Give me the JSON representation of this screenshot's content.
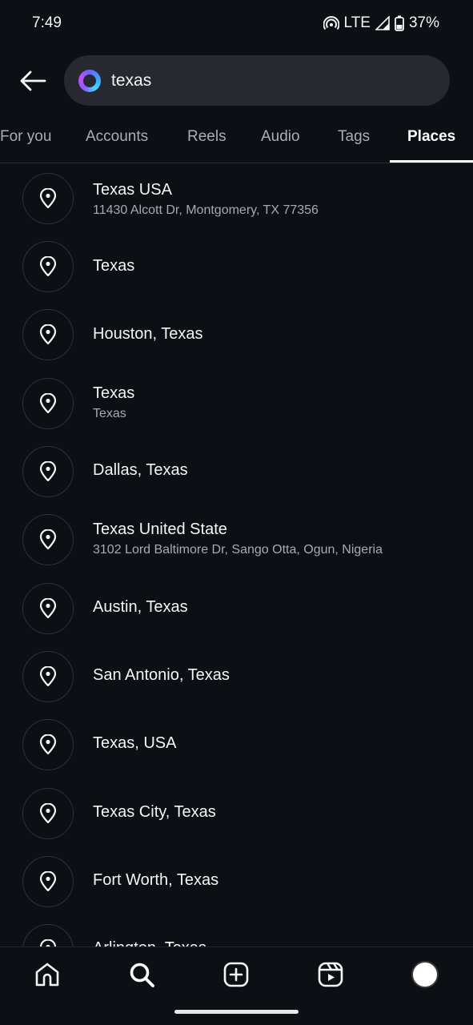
{
  "status_bar": {
    "time": "7:49",
    "network": "LTE",
    "battery": "37%",
    "icons": [
      "hotspot-icon",
      "signal-icon",
      "battery-icon"
    ]
  },
  "search": {
    "query": "texas",
    "logo_icon": "meta-ai-ring-icon",
    "back_icon": "back-arrow-icon"
  },
  "tabs": [
    {
      "label": "For you",
      "active": false
    },
    {
      "label": "Accounts",
      "active": false
    },
    {
      "label": "Reels",
      "active": false
    },
    {
      "label": "Audio",
      "active": false
    },
    {
      "label": "Tags",
      "active": false
    },
    {
      "label": "Places",
      "active": true
    }
  ],
  "places": [
    {
      "name": "Texas USA",
      "address": "11430 Alcott Dr, Montgomery, TX 77356"
    },
    {
      "name": "Texas",
      "address": ""
    },
    {
      "name": "Houston, Texas",
      "address": ""
    },
    {
      "name": "Texas",
      "address": "Texas"
    },
    {
      "name": "Dallas, Texas",
      "address": ""
    },
    {
      "name": "Texas United State",
      "address": "3102  Lord Baltimore Dr, Sango Otta, Ogun, Nigeria"
    },
    {
      "name": "Austin, Texas",
      "address": ""
    },
    {
      "name": "San Antonio, Texas",
      "address": ""
    },
    {
      "name": "Texas, USA",
      "address": ""
    },
    {
      "name": "Texas City, Texas",
      "address": ""
    },
    {
      "name": "Fort Worth, Texas",
      "address": ""
    },
    {
      "name": "Arlington, Texas",
      "address": ""
    }
  ],
  "bottom_nav": {
    "items": [
      "home-icon",
      "search-icon",
      "create-icon",
      "reels-icon",
      "profile-avatar"
    ],
    "active": "search-icon"
  },
  "colors": {
    "background": "#0c0f14",
    "search_field": "#262a30",
    "text_primary": "#f5f5f5",
    "text_secondary": "#a6abb2"
  }
}
